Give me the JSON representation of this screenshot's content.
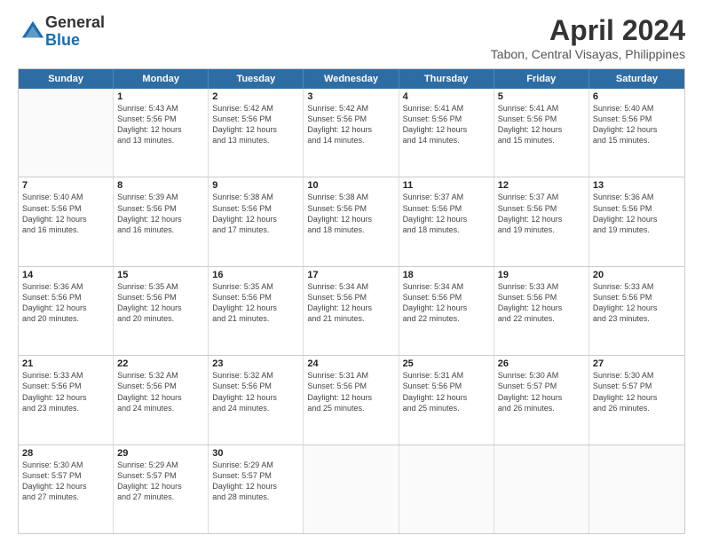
{
  "logo": {
    "general": "General",
    "blue": "Blue"
  },
  "title": "April 2024",
  "subtitle": "Tabon, Central Visayas, Philippines",
  "calendar": {
    "headers": [
      "Sunday",
      "Monday",
      "Tuesday",
      "Wednesday",
      "Thursday",
      "Friday",
      "Saturday"
    ],
    "weeks": [
      [
        {
          "day": "",
          "text": ""
        },
        {
          "day": "1",
          "text": "Sunrise: 5:43 AM\nSunset: 5:56 PM\nDaylight: 12 hours\nand 13 minutes."
        },
        {
          "day": "2",
          "text": "Sunrise: 5:42 AM\nSunset: 5:56 PM\nDaylight: 12 hours\nand 13 minutes."
        },
        {
          "day": "3",
          "text": "Sunrise: 5:42 AM\nSunset: 5:56 PM\nDaylight: 12 hours\nand 14 minutes."
        },
        {
          "day": "4",
          "text": "Sunrise: 5:41 AM\nSunset: 5:56 PM\nDaylight: 12 hours\nand 14 minutes."
        },
        {
          "day": "5",
          "text": "Sunrise: 5:41 AM\nSunset: 5:56 PM\nDaylight: 12 hours\nand 15 minutes."
        },
        {
          "day": "6",
          "text": "Sunrise: 5:40 AM\nSunset: 5:56 PM\nDaylight: 12 hours\nand 15 minutes."
        }
      ],
      [
        {
          "day": "7",
          "text": "Sunrise: 5:40 AM\nSunset: 5:56 PM\nDaylight: 12 hours\nand 16 minutes."
        },
        {
          "day": "8",
          "text": "Sunrise: 5:39 AM\nSunset: 5:56 PM\nDaylight: 12 hours\nand 16 minutes."
        },
        {
          "day": "9",
          "text": "Sunrise: 5:38 AM\nSunset: 5:56 PM\nDaylight: 12 hours\nand 17 minutes."
        },
        {
          "day": "10",
          "text": "Sunrise: 5:38 AM\nSunset: 5:56 PM\nDaylight: 12 hours\nand 18 minutes."
        },
        {
          "day": "11",
          "text": "Sunrise: 5:37 AM\nSunset: 5:56 PM\nDaylight: 12 hours\nand 18 minutes."
        },
        {
          "day": "12",
          "text": "Sunrise: 5:37 AM\nSunset: 5:56 PM\nDaylight: 12 hours\nand 19 minutes."
        },
        {
          "day": "13",
          "text": "Sunrise: 5:36 AM\nSunset: 5:56 PM\nDaylight: 12 hours\nand 19 minutes."
        }
      ],
      [
        {
          "day": "14",
          "text": "Sunrise: 5:36 AM\nSunset: 5:56 PM\nDaylight: 12 hours\nand 20 minutes."
        },
        {
          "day": "15",
          "text": "Sunrise: 5:35 AM\nSunset: 5:56 PM\nDaylight: 12 hours\nand 20 minutes."
        },
        {
          "day": "16",
          "text": "Sunrise: 5:35 AM\nSunset: 5:56 PM\nDaylight: 12 hours\nand 21 minutes."
        },
        {
          "day": "17",
          "text": "Sunrise: 5:34 AM\nSunset: 5:56 PM\nDaylight: 12 hours\nand 21 minutes."
        },
        {
          "day": "18",
          "text": "Sunrise: 5:34 AM\nSunset: 5:56 PM\nDaylight: 12 hours\nand 22 minutes."
        },
        {
          "day": "19",
          "text": "Sunrise: 5:33 AM\nSunset: 5:56 PM\nDaylight: 12 hours\nand 22 minutes."
        },
        {
          "day": "20",
          "text": "Sunrise: 5:33 AM\nSunset: 5:56 PM\nDaylight: 12 hours\nand 23 minutes."
        }
      ],
      [
        {
          "day": "21",
          "text": "Sunrise: 5:33 AM\nSunset: 5:56 PM\nDaylight: 12 hours\nand 23 minutes."
        },
        {
          "day": "22",
          "text": "Sunrise: 5:32 AM\nSunset: 5:56 PM\nDaylight: 12 hours\nand 24 minutes."
        },
        {
          "day": "23",
          "text": "Sunrise: 5:32 AM\nSunset: 5:56 PM\nDaylight: 12 hours\nand 24 minutes."
        },
        {
          "day": "24",
          "text": "Sunrise: 5:31 AM\nSunset: 5:56 PM\nDaylight: 12 hours\nand 25 minutes."
        },
        {
          "day": "25",
          "text": "Sunrise: 5:31 AM\nSunset: 5:56 PM\nDaylight: 12 hours\nand 25 minutes."
        },
        {
          "day": "26",
          "text": "Sunrise: 5:30 AM\nSunset: 5:57 PM\nDaylight: 12 hours\nand 26 minutes."
        },
        {
          "day": "27",
          "text": "Sunrise: 5:30 AM\nSunset: 5:57 PM\nDaylight: 12 hours\nand 26 minutes."
        }
      ],
      [
        {
          "day": "28",
          "text": "Sunrise: 5:30 AM\nSunset: 5:57 PM\nDaylight: 12 hours\nand 27 minutes."
        },
        {
          "day": "29",
          "text": "Sunrise: 5:29 AM\nSunset: 5:57 PM\nDaylight: 12 hours\nand 27 minutes."
        },
        {
          "day": "30",
          "text": "Sunrise: 5:29 AM\nSunset: 5:57 PM\nDaylight: 12 hours\nand 28 minutes."
        },
        {
          "day": "",
          "text": ""
        },
        {
          "day": "",
          "text": ""
        },
        {
          "day": "",
          "text": ""
        },
        {
          "day": "",
          "text": ""
        }
      ]
    ]
  }
}
